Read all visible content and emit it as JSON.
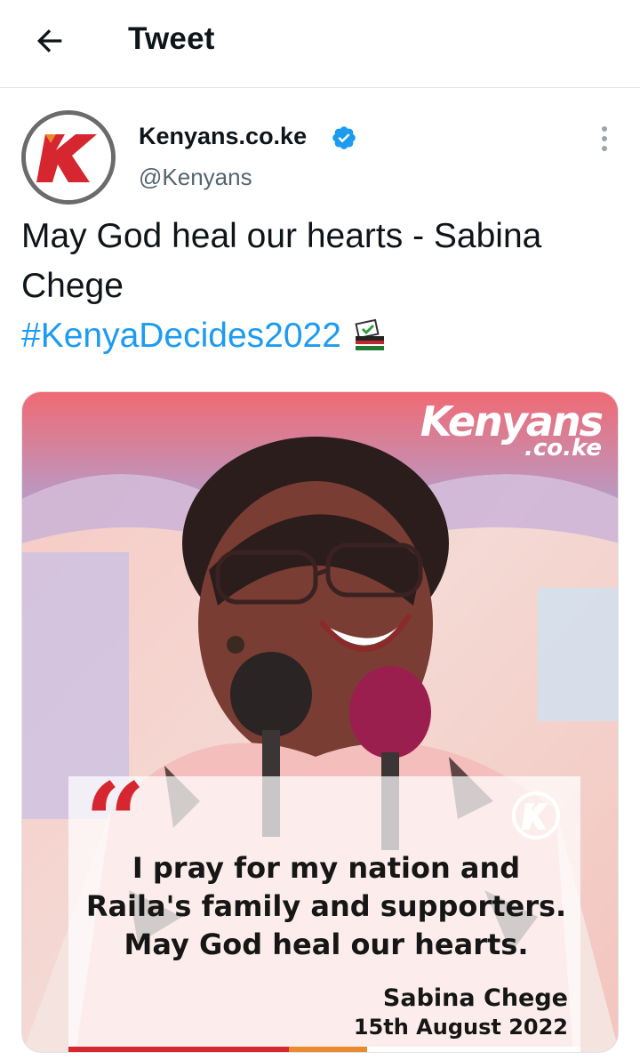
{
  "header": {
    "title": "Tweet",
    "back_icon": "arrow-left-icon"
  },
  "author": {
    "name": "Kenyans.co.ke",
    "handle": "@Kenyans",
    "verified": true,
    "avatar_letter": "K"
  },
  "tweet": {
    "text": "May God heal our hearts - Sabina Chege",
    "hashtag": "#KenyaDecides2022",
    "emoji_icon": "ballot-box-icon"
  },
  "media": {
    "watermark_main": "Kenyans",
    "watermark_sub": ".co.ke",
    "quote_text": "I pray for my nation and Raila's family and supporters. May God heal our hearts.",
    "quote_author": "Sabina Chege",
    "quote_date": "15th August 2022"
  },
  "colors": {
    "accent_blue": "#1d9bf0",
    "brand_red": "#d6262f"
  }
}
